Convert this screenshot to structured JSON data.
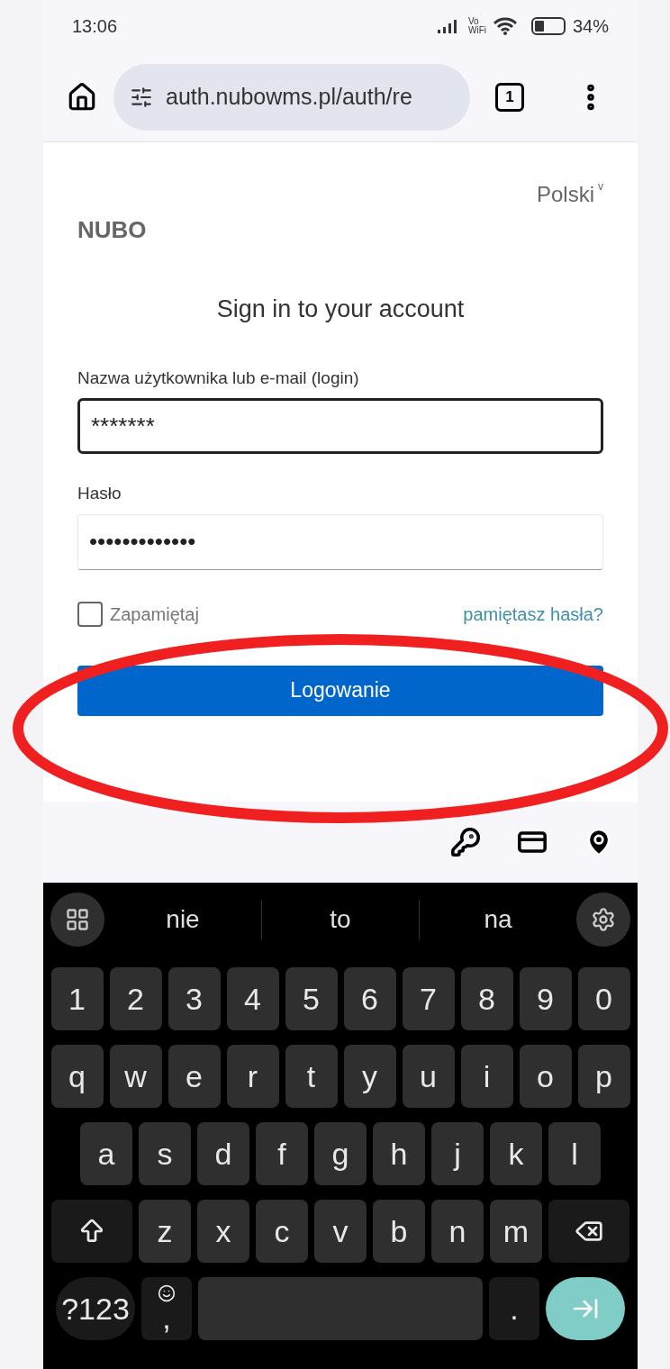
{
  "status_bar": {
    "time": "13:06",
    "wifi_label_top": "Vo",
    "wifi_label_bottom": "WiFi",
    "battery_fill": {
      "level": 0.34
    },
    "battery": "34%"
  },
  "browser": {
    "url": "auth.nubowms.pl/auth/re",
    "tab_count": "1"
  },
  "page": {
    "language": "Polski",
    "language_caret": "v",
    "logo": "NUBO",
    "heading": "Sign in to your account",
    "fields": [
      {
        "label": "Nazwa użytkownika lub e-mail (login)",
        "value": "*******",
        "focused": true
      },
      {
        "label": "Hasło",
        "value": "•••••••••••••",
        "focused": false
      }
    ],
    "remember": {
      "label": "Zapamiętaj",
      "checked": false
    },
    "forgot_link": "pamiętasz hasła?",
    "submit": "Logowanie"
  },
  "keyboard": {
    "suggestions": [
      "nie",
      "to",
      "na"
    ],
    "rows": [
      [
        {
          "kind": "char",
          "label": "1"
        },
        {
          "kind": "char",
          "label": "2"
        },
        {
          "kind": "char",
          "label": "3"
        },
        {
          "kind": "char",
          "label": "4"
        },
        {
          "kind": "char",
          "label": "5"
        },
        {
          "kind": "char",
          "label": "6"
        },
        {
          "kind": "char",
          "label": "7"
        },
        {
          "kind": "char",
          "label": "8"
        },
        {
          "kind": "char",
          "label": "9"
        },
        {
          "kind": "char",
          "label": "0"
        }
      ],
      [
        {
          "kind": "char",
          "label": "q"
        },
        {
          "kind": "char",
          "label": "w"
        },
        {
          "kind": "char",
          "label": "e"
        },
        {
          "kind": "char",
          "label": "r"
        },
        {
          "kind": "char",
          "label": "t"
        },
        {
          "kind": "char",
          "label": "y"
        },
        {
          "kind": "char",
          "label": "u"
        },
        {
          "kind": "char",
          "label": "i"
        },
        {
          "kind": "char",
          "label": "o"
        },
        {
          "kind": "char",
          "label": "p"
        }
      ],
      [
        {
          "kind": "char",
          "label": "a"
        },
        {
          "kind": "char",
          "label": "s"
        },
        {
          "kind": "char",
          "label": "d"
        },
        {
          "kind": "char",
          "label": "f"
        },
        {
          "kind": "char",
          "label": "g"
        },
        {
          "kind": "char",
          "label": "h"
        },
        {
          "kind": "char",
          "label": "j"
        },
        {
          "kind": "char",
          "label": "k"
        },
        {
          "kind": "char",
          "label": "l"
        }
      ],
      [
        {
          "kind": "shift"
        },
        {
          "kind": "char",
          "label": "z"
        },
        {
          "kind": "char",
          "label": "x"
        },
        {
          "kind": "char",
          "label": "c"
        },
        {
          "kind": "char",
          "label": "v"
        },
        {
          "kind": "char",
          "label": "b"
        },
        {
          "kind": "char",
          "label": "n"
        },
        {
          "kind": "char",
          "label": "m"
        },
        {
          "kind": "backspace"
        }
      ],
      [
        {
          "kind": "symbols",
          "label": "?123"
        },
        {
          "kind": "emoji",
          "label": ","
        },
        {
          "kind": "space"
        },
        {
          "kind": "period",
          "label": "."
        },
        {
          "kind": "enter"
        }
      ]
    ]
  }
}
